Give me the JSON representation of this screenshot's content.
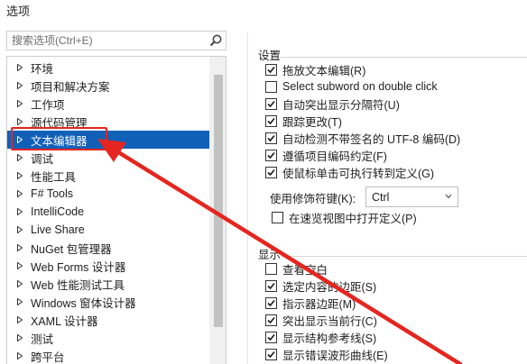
{
  "window": {
    "title": "选项"
  },
  "search": {
    "placeholder": "搜索选项(Ctrl+E)"
  },
  "tree": {
    "items": [
      {
        "label": "环境",
        "selected": false
      },
      {
        "label": "项目和解决方案",
        "selected": false
      },
      {
        "label": "工作项",
        "selected": false
      },
      {
        "label": "源代码管理",
        "selected": false
      },
      {
        "label": "文本编辑器",
        "selected": true
      },
      {
        "label": "调试",
        "selected": false
      },
      {
        "label": "性能工具",
        "selected": false
      },
      {
        "label": "F# Tools",
        "selected": false
      },
      {
        "label": "IntelliCode",
        "selected": false
      },
      {
        "label": "Live Share",
        "selected": false
      },
      {
        "label": "NuGet 包管理器",
        "selected": false
      },
      {
        "label": "Web Forms 设计器",
        "selected": false
      },
      {
        "label": "Web 性能测试工具",
        "selected": false
      },
      {
        "label": "Windows 窗体设计器",
        "selected": false
      },
      {
        "label": "XAML 设计器",
        "selected": false
      },
      {
        "label": "测试",
        "selected": false
      },
      {
        "label": "跨平台",
        "selected": false
      }
    ]
  },
  "settings": {
    "title": "设置",
    "options": [
      {
        "label": "拖放文本编辑(R)",
        "checked": true
      },
      {
        "label": "Select subword on double click",
        "checked": false
      },
      {
        "label": "自动突出显示分隔符(U)",
        "checked": true
      },
      {
        "label": "跟踪更改(T)",
        "checked": true
      },
      {
        "label": "自动检测不带签名的 UTF-8 编码(D)",
        "checked": true
      },
      {
        "label": "遵循项目编码约定(F)",
        "checked": true
      },
      {
        "label": "使鼠标单击可执行转到定义(G)",
        "checked": true
      }
    ],
    "modifier_label": "使用修饰符键(K):",
    "modifier_value": "Ctrl",
    "peek_option": {
      "label": "在速览视图中打开定义(P)",
      "checked": false
    }
  },
  "display": {
    "title": "显示",
    "options": [
      {
        "label": "查看空白",
        "checked": false
      },
      {
        "label": "选定内容的边距(S)",
        "checked": true
      },
      {
        "label": "指示器边距(M)",
        "checked": true
      },
      {
        "label": "突出显示当前行(C)",
        "checked": true
      },
      {
        "label": "显示结构参考线(S)",
        "checked": true
      },
      {
        "label": "显示错误波形曲线(E)",
        "checked": true
      }
    ]
  },
  "colors": {
    "selection": "#1160b8",
    "annotation": "#e5251f"
  }
}
